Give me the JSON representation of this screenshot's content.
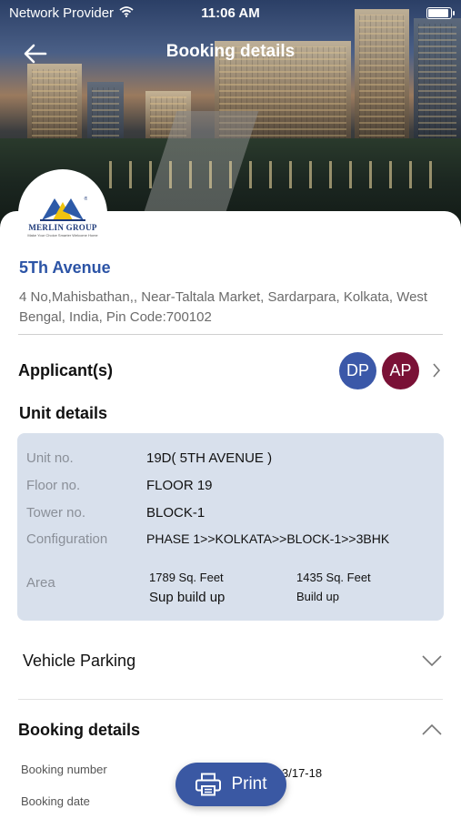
{
  "status_bar": {
    "carrier": "Network Provider",
    "time": "11:06 AM"
  },
  "header": {
    "title": "Booking details"
  },
  "logo": {
    "name": "MERLIN GROUP",
    "tagline": "Make Your Choice Smarter Welcome Home"
  },
  "project": {
    "name": "5Th Avenue",
    "address": "4 No,Mahisbathan,, Near-Taltala Market, Sardarpara, Kolkata, West Bengal, India, Pin Code:700102"
  },
  "applicants": {
    "label": "Applicant(s)",
    "avatars": [
      {
        "initials": "DP",
        "color": "#3b58a8"
      },
      {
        "initials": "AP",
        "color": "#7a1136"
      }
    ]
  },
  "unit_details": {
    "heading": "Unit details",
    "rows": [
      {
        "label": "Unit no.",
        "value": "19D( 5TH AVENUE )"
      },
      {
        "label": "Floor no.",
        "value": "FLOOR 19"
      },
      {
        "label": "Tower no.",
        "value": "BLOCK-1"
      },
      {
        "label": "Configuration",
        "value": "PHASE 1>>KOLKATA>>BLOCK-1>>3BHK"
      }
    ],
    "area": {
      "label": "Area",
      "values": [
        {
          "amount": "1789 Sq. Feet",
          "type": "Sup build up"
        },
        {
          "amount": "1435 Sq. Feet",
          "type": "Build up"
        }
      ]
    }
  },
  "vehicle_parking": {
    "label": "Vehicle Parking"
  },
  "booking_details": {
    "heading": "Booking details",
    "rows": [
      {
        "label": "Booking number",
        "value": "3/17-18"
      },
      {
        "label": "Booking date",
        "value": ""
      }
    ]
  },
  "print_button": {
    "label": "Print"
  },
  "colors": {
    "accent": "#3a58a3",
    "project_name": "#2c54a6",
    "card_bg": "#d8e0ec"
  }
}
